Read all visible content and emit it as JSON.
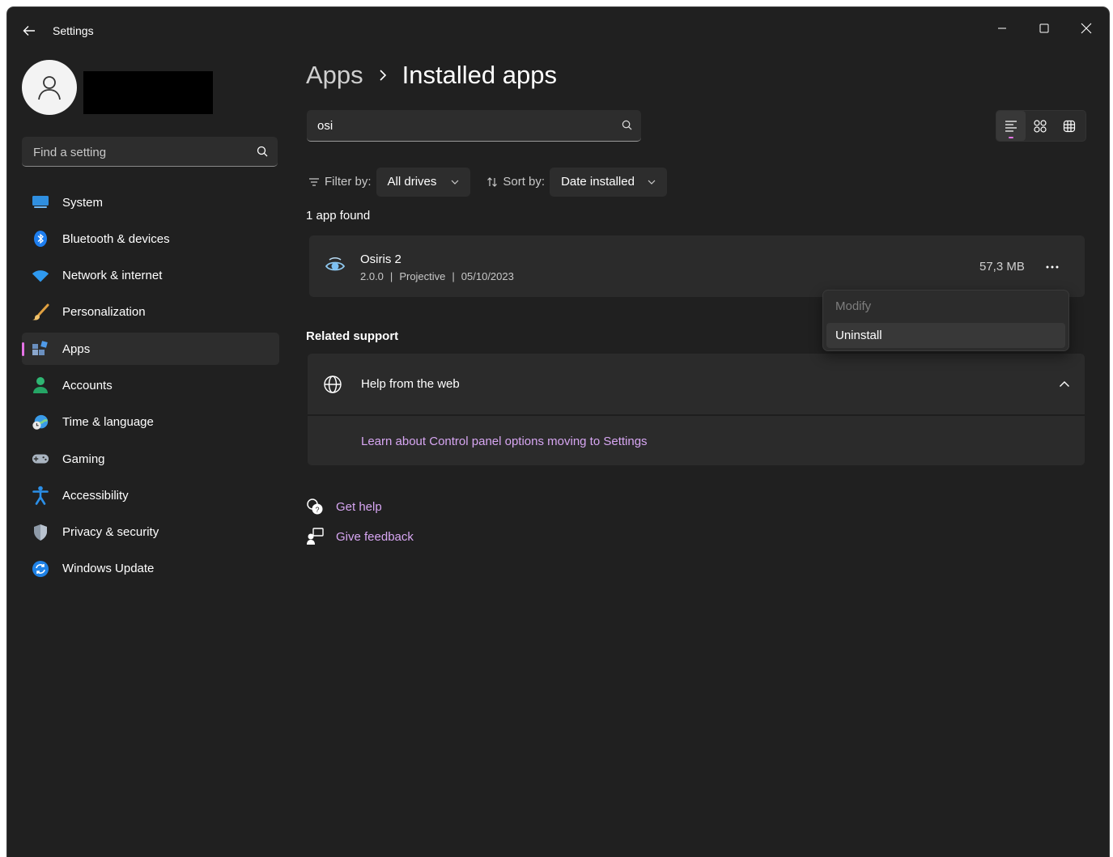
{
  "window": {
    "title": "Settings"
  },
  "sidebar": {
    "search_placeholder": "Find a setting",
    "items": [
      {
        "label": "System",
        "icon": "monitor-icon"
      },
      {
        "label": "Bluetooth & devices",
        "icon": "bluetooth-icon"
      },
      {
        "label": "Network & internet",
        "icon": "wifi-icon"
      },
      {
        "label": "Personalization",
        "icon": "brush-icon"
      },
      {
        "label": "Apps",
        "icon": "apps-icon",
        "active": true
      },
      {
        "label": "Accounts",
        "icon": "person-icon"
      },
      {
        "label": "Time & language",
        "icon": "clock-globe-icon"
      },
      {
        "label": "Gaming",
        "icon": "gamepad-icon"
      },
      {
        "label": "Accessibility",
        "icon": "accessibility-icon"
      },
      {
        "label": "Privacy & security",
        "icon": "shield-icon"
      },
      {
        "label": "Windows Update",
        "icon": "update-icon"
      }
    ]
  },
  "main": {
    "breadcrumb_parent": "Apps",
    "breadcrumb_current": "Installed apps",
    "search_value": "osi",
    "filter_label": "Filter by:",
    "filter_value": "All drives",
    "sort_label": "Sort by:",
    "sort_value": "Date installed",
    "result_count": "1 app found",
    "app": {
      "name": "Osiris 2",
      "version": "2.0.0",
      "publisher": "Projective",
      "date": "05/10/2023",
      "size": "57,3 MB"
    },
    "context_menu": {
      "modify": "Modify",
      "uninstall": "Uninstall"
    },
    "related_support": "Related support",
    "help_from_web": "Help from the web",
    "help_link": "Learn about Control panel options moving to Settings",
    "get_help": "Get help",
    "give_feedback": "Give feedback"
  },
  "colors": {
    "background": "#202020",
    "card": "#2b2b2b",
    "accent": "#e573e6",
    "link": "#d7a6f2"
  }
}
